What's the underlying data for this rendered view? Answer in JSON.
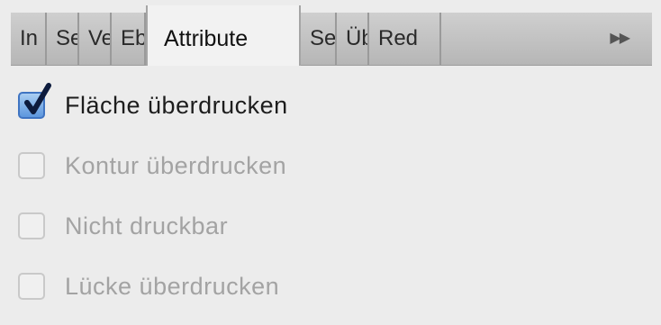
{
  "tabs": [
    {
      "label": "In",
      "active": false
    },
    {
      "label": "Se",
      "active": false
    },
    {
      "label": "Ve",
      "active": false
    },
    {
      "label": "Eb",
      "active": false
    },
    {
      "label": "Attribute",
      "active": true
    },
    {
      "label": "Se",
      "active": false
    },
    {
      "label": "Üb",
      "active": false
    },
    {
      "label": "Red",
      "active": false
    }
  ],
  "overflow_icon": "double-chevron-right-icon",
  "options": [
    {
      "label": "Fläche überdrucken",
      "checked": true,
      "enabled": true
    },
    {
      "label": "Kontur überdrucken",
      "checked": false,
      "enabled": false
    },
    {
      "label": "Nicht druckbar",
      "checked": false,
      "enabled": false
    },
    {
      "label": "Lücke überdrucken",
      "checked": false,
      "enabled": false
    }
  ],
  "colors": {
    "background": "#ececec",
    "checkbox_accent": "#3f74c2",
    "disabled_text": "#a3a3a3"
  }
}
